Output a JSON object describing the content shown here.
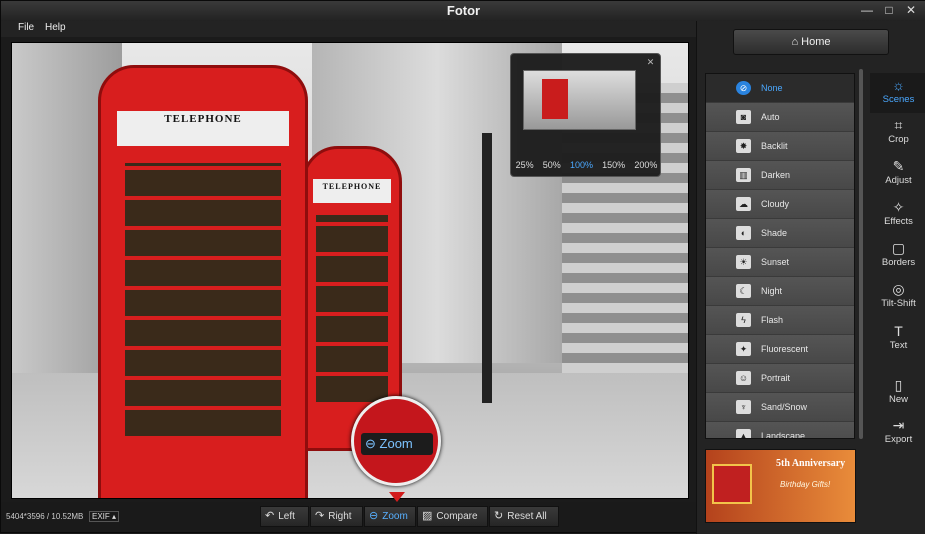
{
  "window": {
    "title": "Fotor",
    "min_glyph": "—",
    "max_glyph": "□",
    "close_glyph": "✕"
  },
  "menu": [
    "File",
    "Help"
  ],
  "photo": {
    "booth_sign_1": "TELEPHONE",
    "booth_sign_2": "TELEPHONE"
  },
  "navigator": {
    "close_glyph": "✕",
    "zoom_levels": [
      "25%",
      "50%",
      "100%",
      "150%",
      "200%"
    ],
    "active_zoom": "100%"
  },
  "zoom_callout": {
    "label": "Zoom"
  },
  "status": {
    "image_info": "5404*3596 / 10.52MB",
    "exif_label": "EXIF ▴"
  },
  "toolbar": {
    "left": "Left",
    "right": "Right",
    "zoom": "Zoom",
    "compare": "Compare",
    "reset_all": "Reset All"
  },
  "right_panel": {
    "home": "Home",
    "scenes": [
      {
        "label": "None",
        "icon": "none-icon",
        "glyph": "⊘",
        "active": true
      },
      {
        "label": "Auto",
        "icon": "camera-icon",
        "glyph": "◙"
      },
      {
        "label": "Backlit",
        "icon": "backlit-icon",
        "glyph": "✸"
      },
      {
        "label": "Darken",
        "icon": "darken-icon",
        "glyph": "▥"
      },
      {
        "label": "Cloudy",
        "icon": "cloud-icon",
        "glyph": "☁"
      },
      {
        "label": "Shade",
        "icon": "shade-icon",
        "glyph": "◐"
      },
      {
        "label": "Sunset",
        "icon": "sunset-icon",
        "glyph": "☀"
      },
      {
        "label": "Night",
        "icon": "moon-icon",
        "glyph": "☾"
      },
      {
        "label": "Flash",
        "icon": "flash-icon",
        "glyph": "ϟ"
      },
      {
        "label": "Fluorescent",
        "icon": "fluorescent-icon",
        "glyph": "✦"
      },
      {
        "label": "Portrait",
        "icon": "portrait-icon",
        "glyph": "☺"
      },
      {
        "label": "Sand/Snow",
        "icon": "palm-icon",
        "glyph": "♆"
      },
      {
        "label": "Landscape",
        "icon": "landscape-icon",
        "glyph": "▲"
      }
    ],
    "tools": [
      {
        "label": "Scenes",
        "icon": "sun-icon",
        "glyph": "☼",
        "active": true
      },
      {
        "label": "Crop",
        "icon": "crop-icon",
        "glyph": "⌗"
      },
      {
        "label": "Adjust",
        "icon": "pencil-icon",
        "glyph": "✎"
      },
      {
        "label": "Effects",
        "icon": "sparkle-icon",
        "glyph": "✧"
      },
      {
        "label": "Borders",
        "icon": "border-icon",
        "glyph": "▢"
      },
      {
        "label": "Tilt-Shift",
        "icon": "target-icon",
        "glyph": "◎"
      },
      {
        "label": "Text",
        "icon": "text-icon",
        "glyph": "T"
      },
      {
        "label": "New",
        "icon": "new-file-icon",
        "glyph": "▯"
      },
      {
        "label": "Export",
        "icon": "export-icon",
        "glyph": "⇥"
      }
    ],
    "ad": {
      "headline": "5th Anniversary",
      "subline": "Birthday Gifts!"
    }
  },
  "colors": {
    "accent": "#4aa8ff",
    "booth_red": "#d81e1e",
    "callout_red": "#c4161c"
  }
}
